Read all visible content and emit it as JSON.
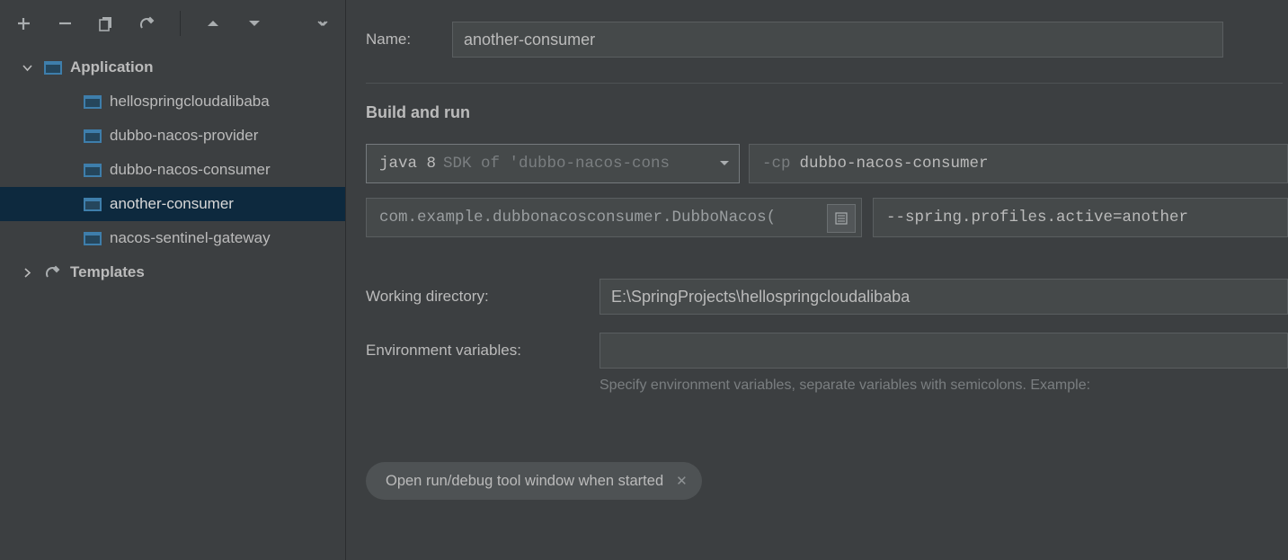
{
  "sidebar": {
    "groups": [
      {
        "label": "Application",
        "expanded": true,
        "type": "app",
        "items": [
          {
            "label": "hellospringcloudalibaba",
            "selected": false
          },
          {
            "label": "dubbo-nacos-provider",
            "selected": false
          },
          {
            "label": "dubbo-nacos-consumer",
            "selected": false
          },
          {
            "label": "another-consumer",
            "selected": true
          },
          {
            "label": "nacos-sentinel-gateway",
            "selected": false
          }
        ]
      },
      {
        "label": "Templates",
        "expanded": false,
        "type": "templates",
        "items": []
      }
    ]
  },
  "form": {
    "name_label": "Name:",
    "name_value": "another-consumer",
    "section_build": "Build and run",
    "sdk_strong": "java 8",
    "sdk_dim": "SDK of 'dubbo-nacos-cons",
    "cp_prefix": "-cp",
    "cp_module": "dubbo-nacos-consumer",
    "main_class": "com.example.dubbonacosconsumer.DubboNacos(",
    "program_args": "--spring.profiles.active=another",
    "wd_label": "Working directory:",
    "wd_value": "E:\\SpringProjects\\hellospringcloudalibaba",
    "env_label": "Environment variables:",
    "env_value": "",
    "env_hint": "Specify environment variables, separate variables with semicolons. Example:",
    "chip_label": "Open run/debug tool window when started"
  }
}
